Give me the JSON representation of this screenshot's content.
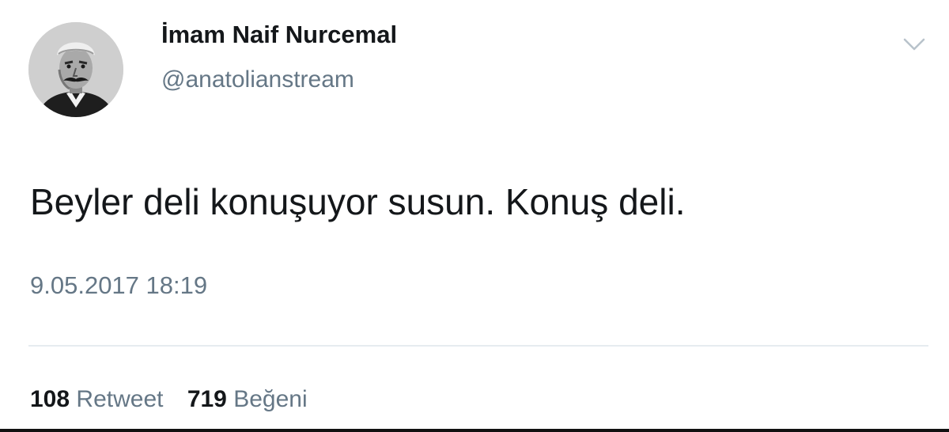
{
  "author": {
    "display_name": "İmam Naif Nurcemal",
    "handle": "@anatolianstream",
    "avatar_icon": "portrait-avatar"
  },
  "tweet": {
    "text": "Beyler deli konuşuyor susun. Konuş deli.",
    "timestamp": "9.05.2017 18:19"
  },
  "stats": {
    "retweet_count": "108",
    "retweet_label": "Retweet",
    "like_count": "719",
    "like_label": "Beğeni"
  },
  "menu": {
    "icon": "chevron-down-icon"
  },
  "colors": {
    "text_primary": "#14171a",
    "text_secondary": "#657786",
    "divider": "#e6ecf0",
    "background": "#ffffff"
  }
}
